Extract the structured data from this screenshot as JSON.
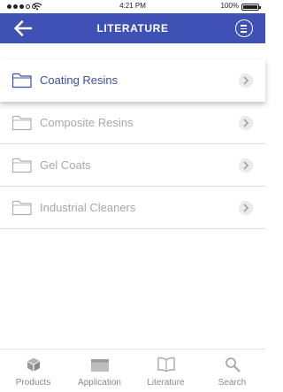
{
  "status": {
    "time": "4:21 PM",
    "battery": "100%"
  },
  "header": {
    "title": "LITERATURE"
  },
  "items": [
    {
      "label": "Coating Resins",
      "active": true
    },
    {
      "label": "Composite Resins",
      "active": false
    },
    {
      "label": "Gel Coats",
      "active": false
    },
    {
      "label": "Industrial Cleaners",
      "active": false
    }
  ],
  "tabs": [
    {
      "label": "Products"
    },
    {
      "label": "Application"
    },
    {
      "label": "Literature"
    },
    {
      "label": "Search"
    }
  ],
  "colors": {
    "header": "#3f51b5",
    "active_text": "#3d4f9e",
    "inactive_text": "#a8a8a8"
  },
  "icons": {
    "back": "arrow-left-icon",
    "menu": "menu-circle-icon",
    "folder": "folder-icon",
    "chevron": "chevron-right-icon"
  }
}
